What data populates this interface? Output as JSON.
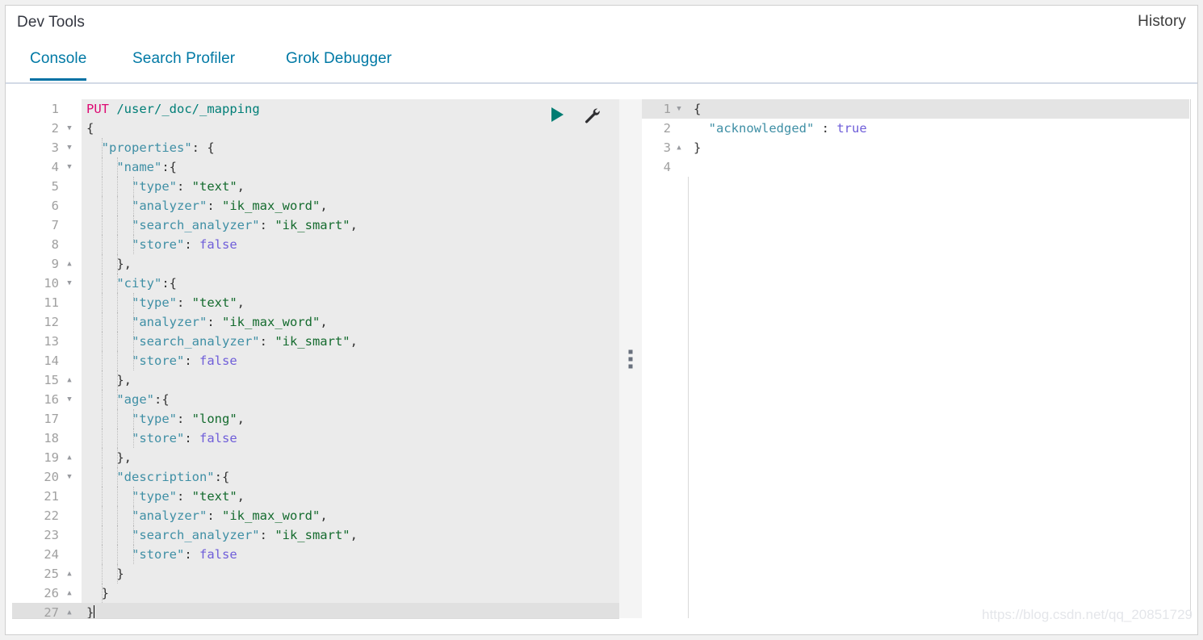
{
  "header": {
    "title": "Dev Tools",
    "history_label": "History"
  },
  "tabs": [
    {
      "label": "Console",
      "active": true
    },
    {
      "label": "Search Profiler",
      "active": false
    },
    {
      "label": "Grok Debugger",
      "active": false
    }
  ],
  "editor": {
    "run_icon": "play-icon",
    "settings_icon": "wrench-icon",
    "active_line": 27,
    "cursor_line": 27,
    "lines": [
      {
        "n": 1,
        "fold": "",
        "indent": 0,
        "tokens": [
          {
            "t": "method",
            "v": "PUT"
          },
          {
            "t": "punct",
            "v": " "
          },
          {
            "t": "url",
            "v": "/user/_doc/_mapping"
          }
        ]
      },
      {
        "n": 2,
        "fold": "down",
        "indent": 0,
        "tokens": [
          {
            "t": "punct",
            "v": "{"
          }
        ]
      },
      {
        "n": 3,
        "fold": "down",
        "indent": 1,
        "tokens": [
          {
            "t": "key",
            "v": "\"properties\""
          },
          {
            "t": "punct",
            "v": ": {"
          }
        ]
      },
      {
        "n": 4,
        "fold": "down",
        "indent": 2,
        "tokens": [
          {
            "t": "key",
            "v": "\"name\""
          },
          {
            "t": "punct",
            "v": ":{"
          }
        ]
      },
      {
        "n": 5,
        "fold": "",
        "indent": 3,
        "tokens": [
          {
            "t": "key",
            "v": "\"type\""
          },
          {
            "t": "punct",
            "v": ": "
          },
          {
            "t": "str",
            "v": "\"text\""
          },
          {
            "t": "punct",
            "v": ","
          }
        ]
      },
      {
        "n": 6,
        "fold": "",
        "indent": 3,
        "tokens": [
          {
            "t": "key",
            "v": "\"analyzer\""
          },
          {
            "t": "punct",
            "v": ": "
          },
          {
            "t": "str",
            "v": "\"ik_max_word\""
          },
          {
            "t": "punct",
            "v": ","
          }
        ]
      },
      {
        "n": 7,
        "fold": "",
        "indent": 3,
        "tokens": [
          {
            "t": "key",
            "v": "\"search_analyzer\""
          },
          {
            "t": "punct",
            "v": ": "
          },
          {
            "t": "str",
            "v": "\"ik_smart\""
          },
          {
            "t": "punct",
            "v": ","
          }
        ]
      },
      {
        "n": 8,
        "fold": "",
        "indent": 3,
        "tokens": [
          {
            "t": "key",
            "v": "\"store\""
          },
          {
            "t": "punct",
            "v": ": "
          },
          {
            "t": "bool",
            "v": "false"
          }
        ]
      },
      {
        "n": 9,
        "fold": "up",
        "indent": 2,
        "tokens": [
          {
            "t": "punct",
            "v": "},"
          }
        ]
      },
      {
        "n": 10,
        "fold": "down",
        "indent": 2,
        "tokens": [
          {
            "t": "key",
            "v": "\"city\""
          },
          {
            "t": "punct",
            "v": ":{"
          }
        ]
      },
      {
        "n": 11,
        "fold": "",
        "indent": 3,
        "tokens": [
          {
            "t": "key",
            "v": "\"type\""
          },
          {
            "t": "punct",
            "v": ": "
          },
          {
            "t": "str",
            "v": "\"text\""
          },
          {
            "t": "punct",
            "v": ","
          }
        ]
      },
      {
        "n": 12,
        "fold": "",
        "indent": 3,
        "tokens": [
          {
            "t": "key",
            "v": "\"analyzer\""
          },
          {
            "t": "punct",
            "v": ": "
          },
          {
            "t": "str",
            "v": "\"ik_max_word\""
          },
          {
            "t": "punct",
            "v": ","
          }
        ]
      },
      {
        "n": 13,
        "fold": "",
        "indent": 3,
        "tokens": [
          {
            "t": "key",
            "v": "\"search_analyzer\""
          },
          {
            "t": "punct",
            "v": ": "
          },
          {
            "t": "str",
            "v": "\"ik_smart\""
          },
          {
            "t": "punct",
            "v": ","
          }
        ]
      },
      {
        "n": 14,
        "fold": "",
        "indent": 3,
        "tokens": [
          {
            "t": "key",
            "v": "\"store\""
          },
          {
            "t": "punct",
            "v": ": "
          },
          {
            "t": "bool",
            "v": "false"
          }
        ]
      },
      {
        "n": 15,
        "fold": "up",
        "indent": 2,
        "tokens": [
          {
            "t": "punct",
            "v": "},"
          }
        ]
      },
      {
        "n": 16,
        "fold": "down",
        "indent": 2,
        "tokens": [
          {
            "t": "key",
            "v": "\"age\""
          },
          {
            "t": "punct",
            "v": ":{"
          }
        ]
      },
      {
        "n": 17,
        "fold": "",
        "indent": 3,
        "tokens": [
          {
            "t": "key",
            "v": "\"type\""
          },
          {
            "t": "punct",
            "v": ": "
          },
          {
            "t": "str",
            "v": "\"long\""
          },
          {
            "t": "punct",
            "v": ","
          }
        ]
      },
      {
        "n": 18,
        "fold": "",
        "indent": 3,
        "tokens": [
          {
            "t": "key",
            "v": "\"store\""
          },
          {
            "t": "punct",
            "v": ": "
          },
          {
            "t": "bool",
            "v": "false"
          }
        ]
      },
      {
        "n": 19,
        "fold": "up",
        "indent": 2,
        "tokens": [
          {
            "t": "punct",
            "v": "},"
          }
        ]
      },
      {
        "n": 20,
        "fold": "down",
        "indent": 2,
        "tokens": [
          {
            "t": "key",
            "v": "\"description\""
          },
          {
            "t": "punct",
            "v": ":{"
          }
        ]
      },
      {
        "n": 21,
        "fold": "",
        "indent": 3,
        "tokens": [
          {
            "t": "key",
            "v": "\"type\""
          },
          {
            "t": "punct",
            "v": ": "
          },
          {
            "t": "str",
            "v": "\"text\""
          },
          {
            "t": "punct",
            "v": ","
          }
        ]
      },
      {
        "n": 22,
        "fold": "",
        "indent": 3,
        "tokens": [
          {
            "t": "key",
            "v": "\"analyzer\""
          },
          {
            "t": "punct",
            "v": ": "
          },
          {
            "t": "str",
            "v": "\"ik_max_word\""
          },
          {
            "t": "punct",
            "v": ","
          }
        ]
      },
      {
        "n": 23,
        "fold": "",
        "indent": 3,
        "tokens": [
          {
            "t": "key",
            "v": "\"search_analyzer\""
          },
          {
            "t": "punct",
            "v": ": "
          },
          {
            "t": "str",
            "v": "\"ik_smart\""
          },
          {
            "t": "punct",
            "v": ","
          }
        ]
      },
      {
        "n": 24,
        "fold": "",
        "indent": 3,
        "tokens": [
          {
            "t": "key",
            "v": "\"store\""
          },
          {
            "t": "punct",
            "v": ": "
          },
          {
            "t": "bool",
            "v": "false"
          }
        ]
      },
      {
        "n": 25,
        "fold": "up",
        "indent": 2,
        "tokens": [
          {
            "t": "punct",
            "v": "}"
          }
        ]
      },
      {
        "n": 26,
        "fold": "up",
        "indent": 1,
        "tokens": [
          {
            "t": "punct",
            "v": "}"
          }
        ]
      },
      {
        "n": 27,
        "fold": "up",
        "indent": 0,
        "tokens": [
          {
            "t": "punct",
            "v": "}"
          }
        ]
      }
    ]
  },
  "response": {
    "active_line": 1,
    "lines": [
      {
        "n": 1,
        "fold": "down",
        "indent": 0,
        "tokens": [
          {
            "t": "punct",
            "v": "{"
          }
        ]
      },
      {
        "n": 2,
        "fold": "",
        "indent": 1,
        "tokens": [
          {
            "t": "key",
            "v": "\"acknowledged\""
          },
          {
            "t": "punct",
            "v": " : "
          },
          {
            "t": "bool",
            "v": "true"
          }
        ]
      },
      {
        "n": 3,
        "fold": "up",
        "indent": 0,
        "tokens": [
          {
            "t": "punct",
            "v": "}"
          }
        ]
      },
      {
        "n": 4,
        "fold": "",
        "indent": 0,
        "tokens": []
      }
    ]
  },
  "splitter": {
    "handle_icon": "drag-handle-icon"
  },
  "watermark": {
    "text": "https://blog.csdn.net/qq_20851729"
  },
  "colors": {
    "accent": "#0079a5",
    "tab_underline": "#0071a4",
    "run_button": "#017d73",
    "method": "#dd0a73",
    "url": "#007e77",
    "key": "#3f8fa5",
    "string": "#146b2e",
    "boolean": "#6f5ed9",
    "editor_bg": "#ebebeb",
    "active_line": "#e0e0e0"
  }
}
